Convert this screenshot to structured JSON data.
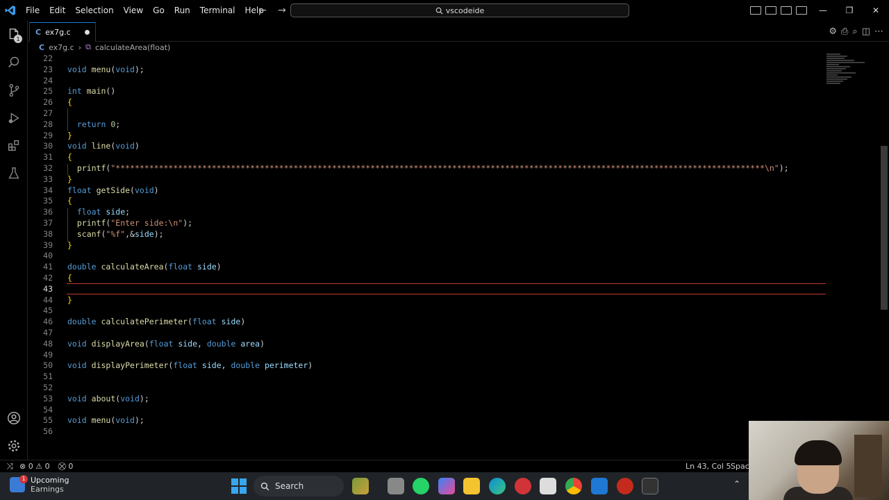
{
  "menu": [
    "File",
    "Edit",
    "Selection",
    "View",
    "Go",
    "Run",
    "Terminal",
    "Help"
  ],
  "command_center": "vscodeide",
  "activity": {
    "explorer_badge": "1"
  },
  "tab": {
    "icon": "C",
    "label": "ex7g.c"
  },
  "breadcrumb": {
    "file": "ex7g.c",
    "symbol": "calculateArea(float)"
  },
  "status": {
    "errors": "0",
    "warnings": "0",
    "ports": "0",
    "position": "Ln 43, Col 5",
    "spaces": "Spaces"
  },
  "taskbar": {
    "weather_title": "Upcoming",
    "weather_sub": "Earnings",
    "weather_badge": "1",
    "search": "Search"
  },
  "code_lines": [
    {
      "n": "22",
      "t": []
    },
    {
      "n": "23",
      "t": [
        [
          "k",
          "void"
        ],
        [
          "",
          "  "
        ],
        [
          "f",
          "menu"
        ],
        [
          "",
          "("
        ],
        [
          "k",
          "void"
        ],
        [
          "",
          ");"
        ]
      ]
    },
    {
      "n": "24",
      "t": []
    },
    {
      "n": "25",
      "t": [
        [
          "k",
          "int"
        ],
        [
          "",
          "  "
        ],
        [
          "f",
          "main"
        ],
        [
          "",
          "()"
        ]
      ]
    },
    {
      "n": "26",
      "t": [
        [
          "p",
          "{"
        ]
      ]
    },
    {
      "n": "27",
      "t": []
    },
    {
      "n": "28",
      "t": [
        [
          "",
          "    "
        ],
        [
          "k",
          "return"
        ],
        [
          "",
          "  "
        ],
        [
          "n",
          "0"
        ],
        [
          "",
          ";"
        ]
      ]
    },
    {
      "n": "29",
      "t": [
        [
          "p",
          "}"
        ]
      ]
    },
    {
      "n": "30",
      "t": [
        [
          "k",
          "void"
        ],
        [
          "",
          "  "
        ],
        [
          "f",
          "line"
        ],
        [
          "",
          "("
        ],
        [
          "k",
          "void"
        ],
        [
          "",
          ")"
        ]
      ]
    },
    {
      "n": "31",
      "t": [
        [
          "p",
          "{"
        ]
      ]
    },
    {
      "n": "32",
      "t": [
        [
          "",
          "    "
        ],
        [
          "f",
          "printf"
        ],
        [
          "",
          "("
        ],
        [
          "s",
          "\"***************************************************************************************************************************************\\n\""
        ],
        [
          "",
          ");"
        ]
      ]
    },
    {
      "n": "33",
      "t": [
        [
          "p",
          "}"
        ]
      ]
    },
    {
      "n": "34",
      "t": [
        [
          "k",
          "float"
        ],
        [
          "",
          "  "
        ],
        [
          "f",
          "getSide"
        ],
        [
          "",
          "("
        ],
        [
          "k",
          "void"
        ],
        [
          "",
          ")"
        ]
      ]
    },
    {
      "n": "35",
      "t": [
        [
          "p",
          "{"
        ]
      ]
    },
    {
      "n": "36",
      "t": [
        [
          "",
          "    "
        ],
        [
          "k",
          "float"
        ],
        [
          "",
          "  "
        ],
        [
          "v",
          "side"
        ],
        [
          "",
          ";"
        ]
      ]
    },
    {
      "n": "37",
      "t": [
        [
          "",
          "    "
        ],
        [
          "f",
          "printf"
        ],
        [
          "",
          "("
        ],
        [
          "s",
          "\"Enter side:\\n\""
        ],
        [
          "",
          ");"
        ]
      ]
    },
    {
      "n": "38",
      "t": [
        [
          "",
          "    "
        ],
        [
          "f",
          "scanf"
        ],
        [
          "",
          "("
        ],
        [
          "s",
          "\"%f\""
        ],
        [
          "",
          ",&"
        ],
        [
          "v",
          "side"
        ],
        [
          "",
          ");"
        ]
      ]
    },
    {
      "n": "39",
      "t": [
        [
          "p",
          "}"
        ]
      ]
    },
    {
      "n": "40",
      "t": []
    },
    {
      "n": "41",
      "t": [
        [
          "k",
          "double"
        ],
        [
          "",
          "  "
        ],
        [
          "f",
          "calculateArea"
        ],
        [
          "",
          "("
        ],
        [
          "k",
          "float"
        ],
        [
          "",
          "  "
        ],
        [
          "v",
          "side"
        ],
        [
          "",
          ")"
        ]
      ]
    },
    {
      "n": "42",
      "t": [
        [
          "p",
          "{"
        ]
      ]
    },
    {
      "n": "43",
      "t": []
    },
    {
      "n": "44",
      "t": [
        [
          "p",
          "}"
        ]
      ]
    },
    {
      "n": "45",
      "t": []
    },
    {
      "n": "46",
      "t": [
        [
          "k",
          "double"
        ],
        [
          "",
          "  "
        ],
        [
          "f",
          "calculatePerimeter"
        ],
        [
          "",
          "("
        ],
        [
          "k",
          "float"
        ],
        [
          "",
          "  "
        ],
        [
          "v",
          "side"
        ],
        [
          "",
          ")"
        ]
      ]
    },
    {
      "n": "47",
      "t": []
    },
    {
      "n": "48",
      "t": [
        [
          "k",
          "void"
        ],
        [
          "",
          "  "
        ],
        [
          "f",
          "displayArea"
        ],
        [
          "",
          "("
        ],
        [
          "k",
          "float"
        ],
        [
          "",
          "  "
        ],
        [
          "v",
          "side"
        ],
        [
          "",
          ",  "
        ],
        [
          "k",
          "double"
        ],
        [
          "",
          "  "
        ],
        [
          "v",
          "area"
        ],
        [
          "",
          ")"
        ]
      ]
    },
    {
      "n": "49",
      "t": []
    },
    {
      "n": "50",
      "t": [
        [
          "k",
          "void"
        ],
        [
          "",
          "  "
        ],
        [
          "f",
          "displayPerimeter"
        ],
        [
          "",
          "("
        ],
        [
          "k",
          "float"
        ],
        [
          "",
          "  "
        ],
        [
          "v",
          "side"
        ],
        [
          "",
          ",  "
        ],
        [
          "k",
          "double"
        ],
        [
          "",
          "  "
        ],
        [
          "v",
          "perimeter"
        ],
        [
          "",
          ")"
        ]
      ]
    },
    {
      "n": "51",
      "t": []
    },
    {
      "n": "52",
      "t": []
    },
    {
      "n": "53",
      "t": [
        [
          "k",
          "void"
        ],
        [
          "",
          "  "
        ],
        [
          "f",
          "about"
        ],
        [
          "",
          "("
        ],
        [
          "k",
          "void"
        ],
        [
          "",
          ");"
        ]
      ]
    },
    {
      "n": "54",
      "t": []
    },
    {
      "n": "55",
      "t": [
        [
          "k",
          "void"
        ],
        [
          "",
          "  "
        ],
        [
          "f",
          "menu"
        ],
        [
          "",
          "("
        ],
        [
          "k",
          "void"
        ],
        [
          "",
          ");"
        ]
      ]
    },
    {
      "n": "56",
      "t": []
    }
  ]
}
